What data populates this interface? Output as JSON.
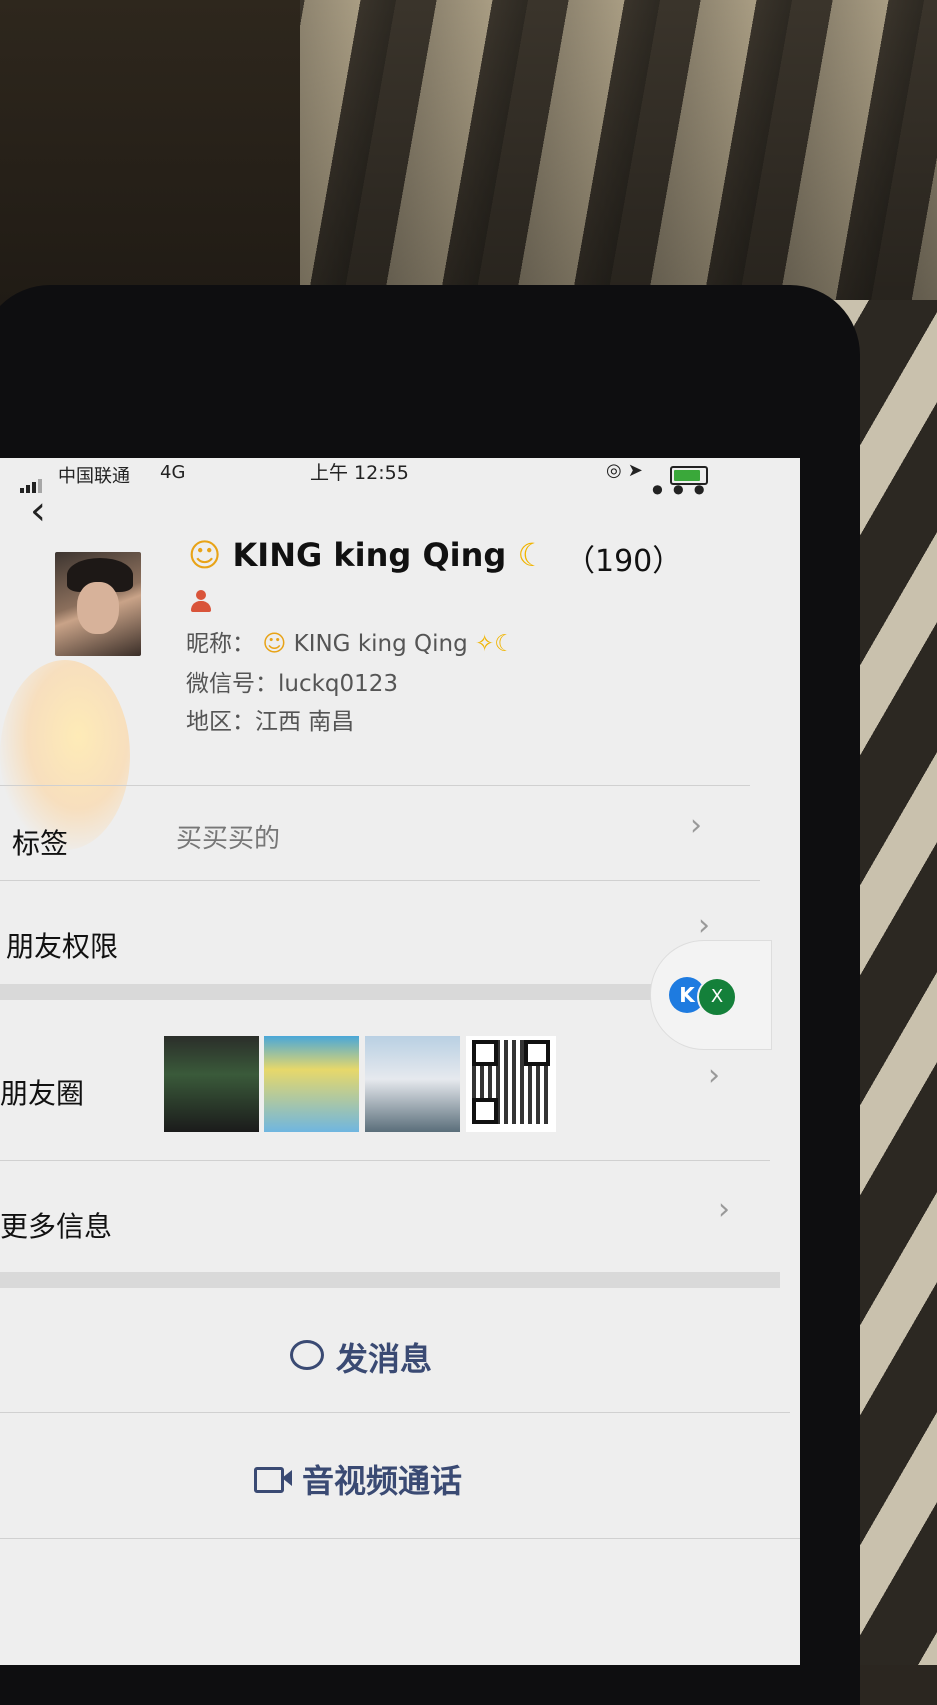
{
  "status_bar": {
    "carrier": "中国联通",
    "network": "4G",
    "time": "上午 12:55"
  },
  "nav": {
    "back_icon": "chevron-left-icon",
    "more_label": "•••"
  },
  "profile": {
    "display_name": "KING king Qing",
    "count": "（190）",
    "nickname_label": "昵称：",
    "nickname_value": "KING king Qing",
    "wechat_id_label": "微信号：",
    "wechat_id_value": "luckq0123",
    "region_label": "地区：",
    "region_value": "江西 南昌"
  },
  "rows": {
    "tags_label": "标签",
    "tags_value": "买买买的",
    "permissions_label": "朋友权限",
    "moments_label": "朋友圈",
    "more_info_label": "更多信息"
  },
  "floating_badge": {
    "k_label": "K",
    "x_label": "X"
  },
  "actions": {
    "send_message": "发消息",
    "av_call": "音视频通话"
  },
  "colors": {
    "screen_bg": "#eeeeee",
    "action_text": "#3a4a73",
    "battery_fill": "#3aa83a"
  }
}
